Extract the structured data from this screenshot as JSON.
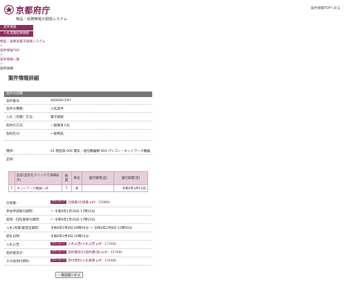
{
  "header": {
    "logo_title": "京都府庁",
    "logo_subtitle": "物品・役務等電子調達システム",
    "top_link": "案件情報TOPへ戻る",
    "brand_color": "#7a1e52"
  },
  "menu": {
    "items": [
      {
        "label": "案件情報",
        "icon": "none"
      },
      {
        "label": "入札実施結果情報",
        "icon": "none"
      }
    ]
  },
  "breadcrumb": {
    "items": [
      "物品・役務等電子調達システム",
      "案件情報TOP",
      "案件情報一覧",
      "案件詳細"
    ],
    "separator": ">"
  },
  "page_title": "案件情報詳細",
  "section_title": "案件の詳細",
  "details": {
    "rows": [
      {
        "label": "案件番号：",
        "value": "4000067297"
      },
      {
        "label": "案件の種類：",
        "value": "入札案件"
      },
      {
        "label": "入札（見積）方法：",
        "value": "電子調達"
      },
      {
        "label": "契約の方法：",
        "value": "一般競争入札"
      },
      {
        "label": "契約区分：",
        "value": "一般用品"
      },
      {
        "label": "種目：",
        "value": "01 物品等 006 電気・通信機器類 004 パソコン・ネットワーク機器"
      },
      {
        "label": "品目：",
        "value": ""
      }
    ]
  },
  "items_table": {
    "headers": [
      "",
      "品名(品名をクリックで詳細表示)",
      "数量",
      "単位",
      "履行期間(自)",
      "履行期間(至)"
    ],
    "rows": [
      [
        "1",
        "ネットワーク機器一式",
        "1",
        "式",
        "",
        "令和6年3月15日"
      ]
    ]
  },
  "schedule": {
    "download_badge": "ダウンロード",
    "rows": [
      {
        "label": "仕様書：",
        "link": "仕様書(仕様書.pdf：150KB)",
        "has_badge": true
      },
      {
        "label": "参加申請受付期間：",
        "value": "～ 令和6年1月30日 17時15分",
        "has_badge": false
      },
      {
        "label": "質問・回答書受付期間：",
        "value": "～ 令和6年1月30日 17時15分",
        "has_badge": false
      },
      {
        "label": "入札(見積)書提出期間：",
        "value": "令和6年2月6日 09時30分 ～ 令和6年2月8日 15時00分",
        "has_badge": false
      },
      {
        "label": "開札日時：",
        "value": "令和6年2月9日 10時15分",
        "has_badge": false
      },
      {
        "label": "入札公告：",
        "link": "入札公告(入札公告.pdf：171KB)",
        "has_badge": true
      },
      {
        "label": "契約書案文：",
        "link": "契約書案文(契約書(案).pdf：227KB)",
        "has_badge": true
      },
      {
        "label": "その他添付資料：",
        "link": "添付資料(入札概要.pdf：101KB)",
        "has_badge": true
      }
    ]
  },
  "back_button": "一覧画面に戻る"
}
